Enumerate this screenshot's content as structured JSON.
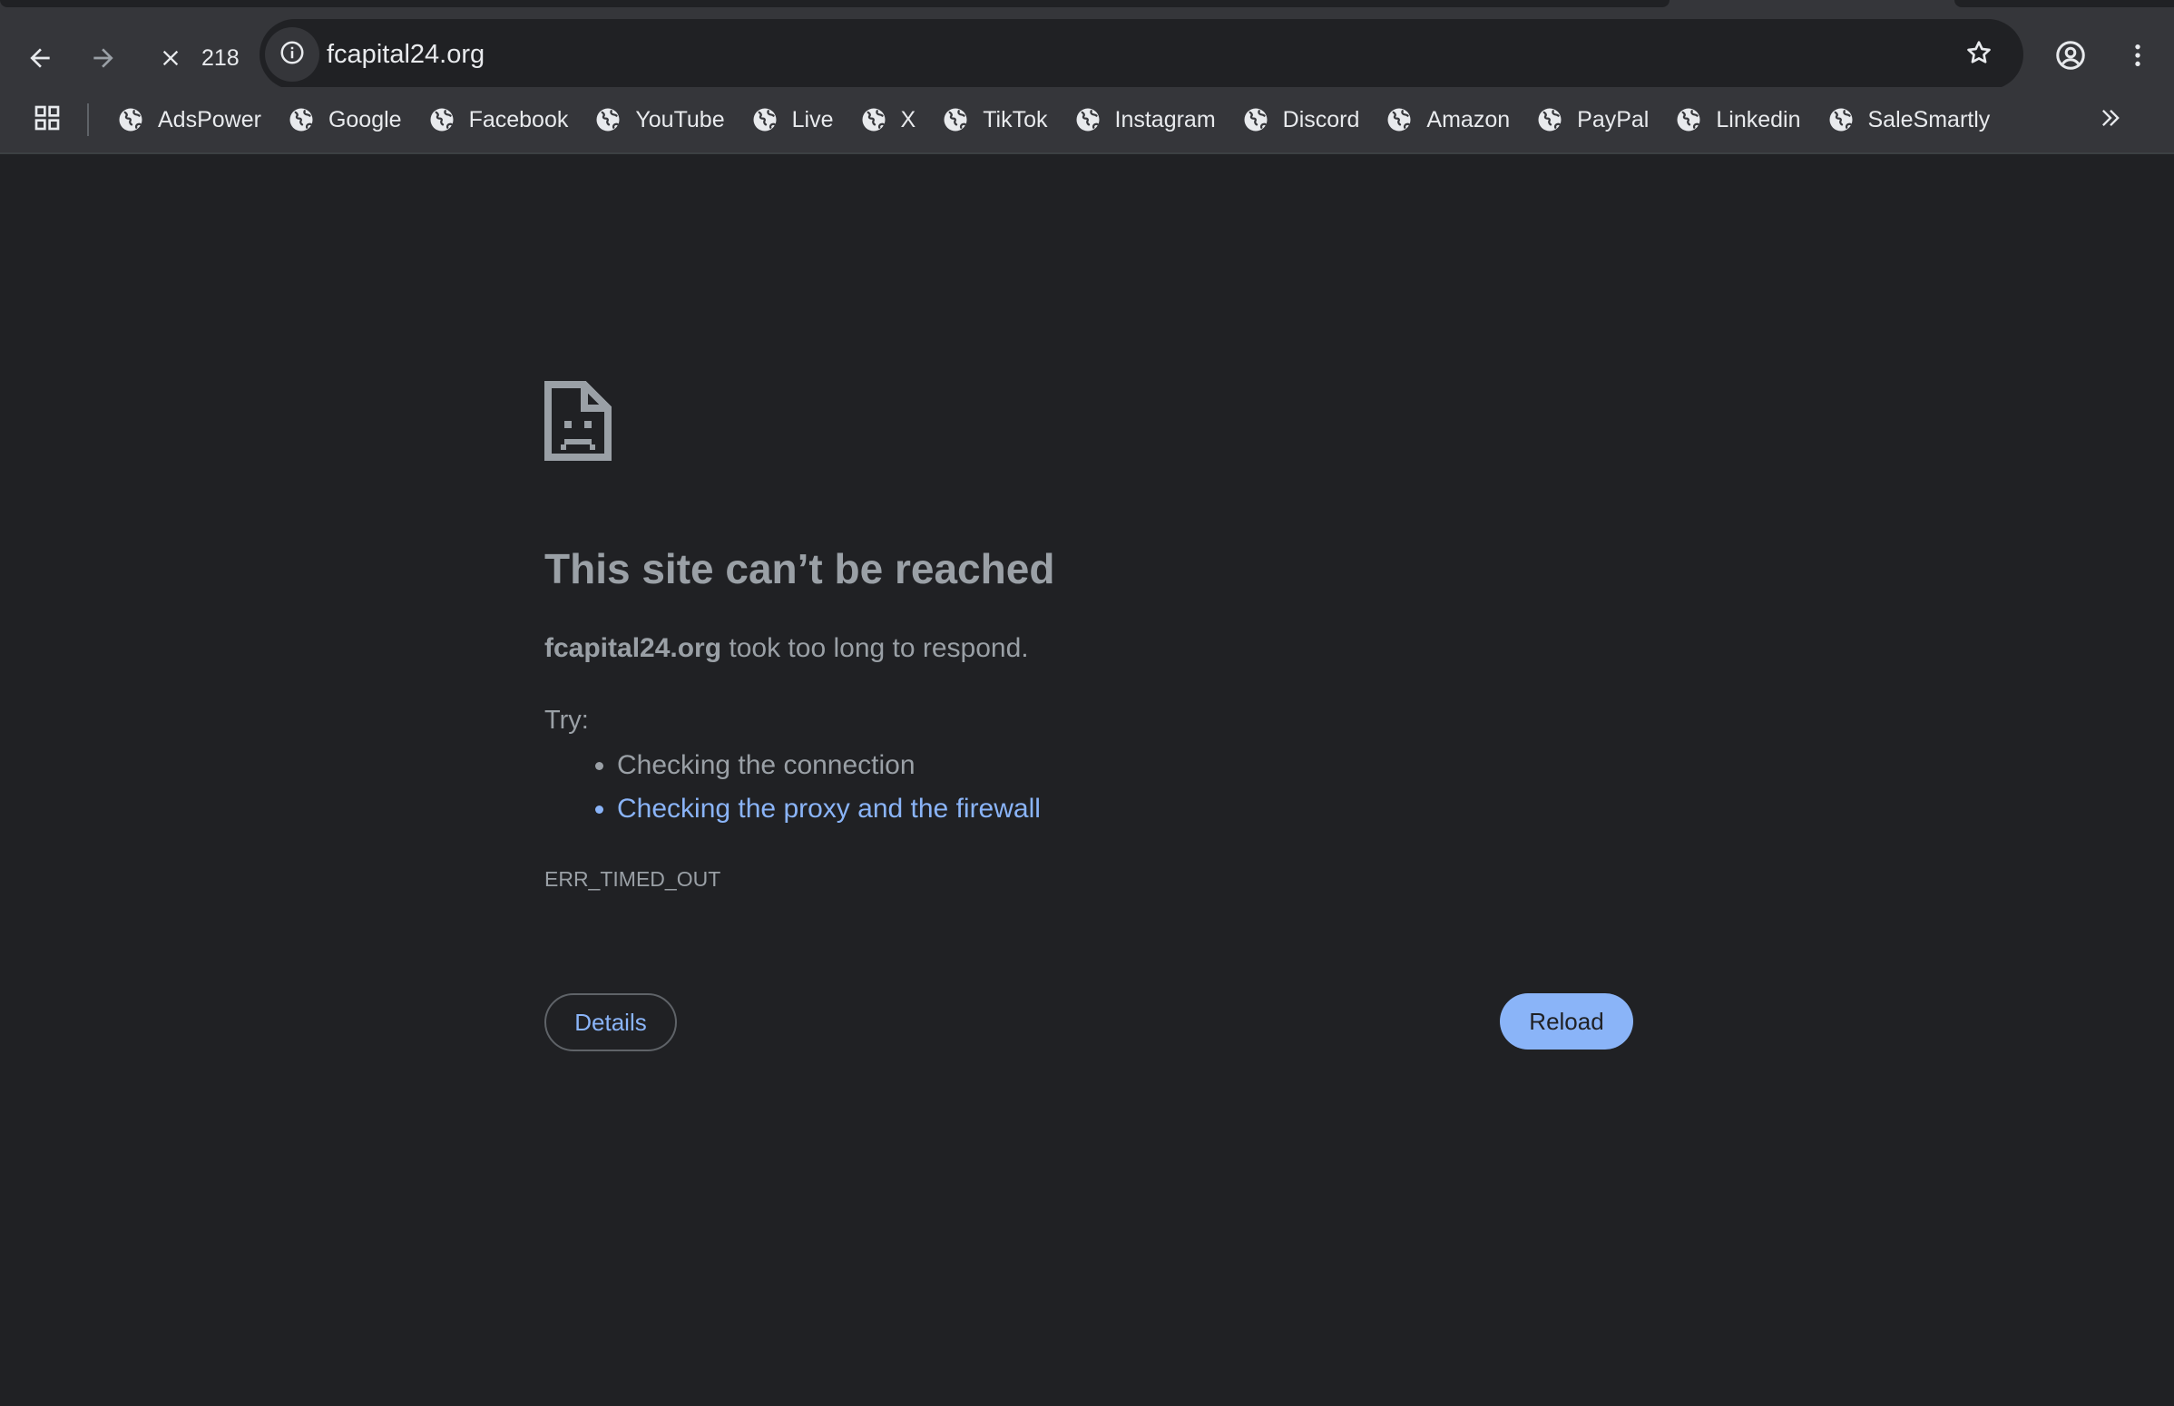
{
  "browser": {
    "loading_count": "218",
    "url": "fcapital24.org",
    "bookmarks": [
      {
        "label": "AdsPower"
      },
      {
        "label": "Google"
      },
      {
        "label": "Facebook"
      },
      {
        "label": "YouTube"
      },
      {
        "label": "Live"
      },
      {
        "label": "X"
      },
      {
        "label": "TikTok"
      },
      {
        "label": "Instagram"
      },
      {
        "label": "Discord"
      },
      {
        "label": "Amazon"
      },
      {
        "label": "PayPal"
      },
      {
        "label": "Linkedin"
      },
      {
        "label": "SaleSmartly"
      }
    ],
    "icons": {
      "back": "back-arrow-icon",
      "forward": "forward-arrow-icon",
      "stop": "stop-loading-icon",
      "site_info": "info-icon",
      "bookmark_star": "star-icon",
      "profile": "account-icon",
      "menu": "more-vert-icon",
      "apps": "apps-grid-icon",
      "bookmark_favicon": "globe-icon",
      "overflow": "double-chevron-icon"
    }
  },
  "error_page": {
    "title": "This site can’t be reached",
    "host": "fcapital24.org",
    "message": " took too long to respond.",
    "try_label": "Try:",
    "suggestions": [
      "Checking the connection",
      "Checking the proxy and the firewall"
    ],
    "error_code": "ERR_TIMED_OUT",
    "details_button": "Details",
    "reload_button": "Reload"
  },
  "colors": {
    "background": "#202124",
    "toolbar": "#35363a",
    "text": "#9aa0a6",
    "link": "#8ab4f8",
    "reload_bg": "#8ab4f8"
  }
}
